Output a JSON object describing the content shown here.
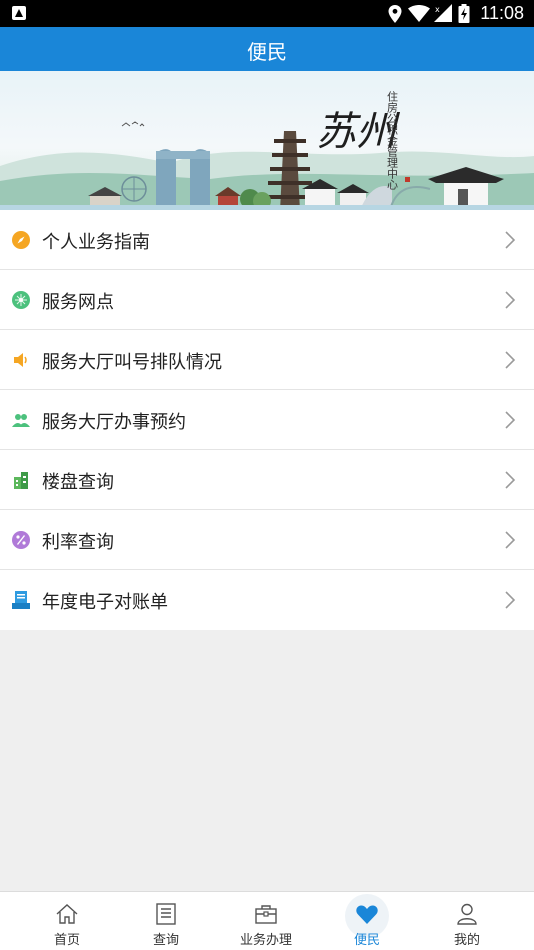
{
  "status_bar": {
    "time": "11:08"
  },
  "header": {
    "title": "便民"
  },
  "banner": {
    "logo_text": "苏州",
    "org_text": "住房公积金管理中心"
  },
  "menu": {
    "items": [
      {
        "label": "个人业务指南",
        "icon": "compass-icon",
        "color": "#f5a623"
      },
      {
        "label": "服务网点",
        "icon": "network-icon",
        "color": "#4cc17d"
      },
      {
        "label": "服务大厅叫号排队情况",
        "icon": "speaker-icon",
        "color": "#f5a623"
      },
      {
        "label": "服务大厅办事预约",
        "icon": "people-icon",
        "color": "#4cc17d"
      },
      {
        "label": "楼盘查询",
        "icon": "building-icon",
        "color": "#5cb85c"
      },
      {
        "label": "利率查询",
        "icon": "percent-icon",
        "color": "#b07ad8"
      },
      {
        "label": "年度电子对账单",
        "icon": "statement-icon",
        "color": "#2f9be0"
      }
    ]
  },
  "tab_bar": {
    "active_color": "#1a86d8",
    "tabs": [
      {
        "label": "首页",
        "icon": "home-icon"
      },
      {
        "label": "查询",
        "icon": "document-icon"
      },
      {
        "label": "业务办理",
        "icon": "briefcase-icon"
      },
      {
        "label": "便民",
        "icon": "heart-icon",
        "active": true
      },
      {
        "label": "我的",
        "icon": "user-icon"
      }
    ]
  }
}
